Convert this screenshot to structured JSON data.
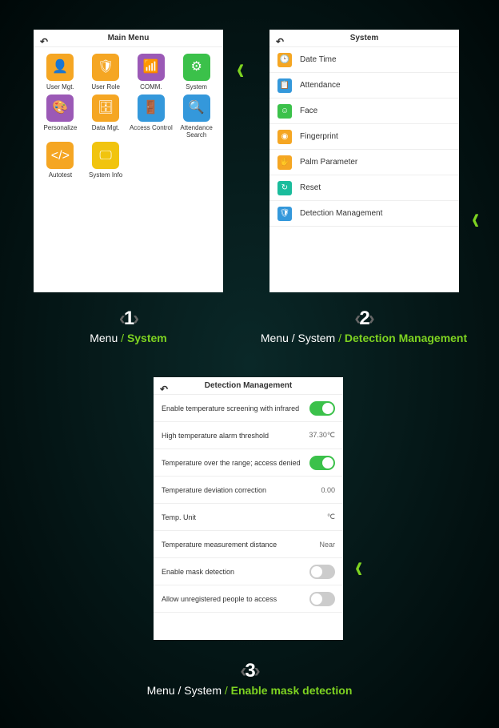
{
  "arrows": {
    "glyph": "‹"
  },
  "screen1": {
    "title": "Main Menu",
    "apps": [
      {
        "label": "User Mgt.",
        "icon": "👤",
        "colorClass": "c-orange"
      },
      {
        "label": "User Role",
        "icon": "🛡",
        "colorClass": "c-orange"
      },
      {
        "label": "COMM.",
        "icon": "📶",
        "colorClass": "c-purple"
      },
      {
        "label": "System",
        "icon": "⚙",
        "colorClass": "c-green"
      },
      {
        "label": "Personalize",
        "icon": "🎨",
        "colorClass": "c-purple"
      },
      {
        "label": "Data Mgt.",
        "icon": "🗄",
        "colorClass": "c-orange"
      },
      {
        "label": "Access Control",
        "icon": "🚪",
        "colorClass": "c-blue"
      },
      {
        "label": "Attendance Search",
        "icon": "🔍",
        "colorClass": "c-blue"
      },
      {
        "label": "Autotest",
        "icon": "</>",
        "colorClass": "c-orange"
      },
      {
        "label": "System Info",
        "icon": "🖵",
        "colorClass": "c-yellow"
      }
    ]
  },
  "screen2": {
    "title": "System",
    "items": [
      {
        "label": "Date Time",
        "icon": "🕒",
        "colorClass": "c-orange"
      },
      {
        "label": "Attendance",
        "icon": "📋",
        "colorClass": "c-blue"
      },
      {
        "label": "Face",
        "icon": "☺",
        "colorClass": "c-green"
      },
      {
        "label": "Fingerprint",
        "icon": "◉",
        "colorClass": "c-orange"
      },
      {
        "label": "Palm Parameter",
        "icon": "✋",
        "colorClass": "c-orange"
      },
      {
        "label": "Reset",
        "icon": "↻",
        "colorClass": "c-teal"
      },
      {
        "label": "Detection Management",
        "icon": "🛡",
        "colorClass": "c-blue"
      }
    ]
  },
  "screen3": {
    "title": "Detection Management",
    "rows": [
      {
        "label": "Enable temperature screening with infrared",
        "value": null,
        "toggle": true,
        "on": true
      },
      {
        "label": "High temperature alarm threshold",
        "value": "37.30℃",
        "toggle": false,
        "on": false
      },
      {
        "label": "Temperature over the range; access denied",
        "value": null,
        "toggle": true,
        "on": true
      },
      {
        "label": "Temperature deviation correction",
        "value": "0.00",
        "toggle": false,
        "on": false
      },
      {
        "label": "Temp. Unit",
        "value": "℃",
        "toggle": false,
        "on": false
      },
      {
        "label": "Temperature measurement distance",
        "value": "Near",
        "toggle": false,
        "on": false
      },
      {
        "label": "Enable mask detection",
        "value": null,
        "toggle": true,
        "on": false
      },
      {
        "label": "Allow unregistered people to access",
        "value": null,
        "toggle": true,
        "on": false
      }
    ]
  },
  "steps": {
    "s1": {
      "num": "1",
      "prefix": "Menu ",
      "hl": "System"
    },
    "s2": {
      "num": "2",
      "prefix": "Menu / System ",
      "hl": "Detection Management"
    },
    "s3": {
      "num": "3",
      "prefix": "Menu / System ",
      "hl": "Enable mask detection"
    },
    "sep": "/ ",
    "chevL": "‹",
    "chevR": "›"
  }
}
